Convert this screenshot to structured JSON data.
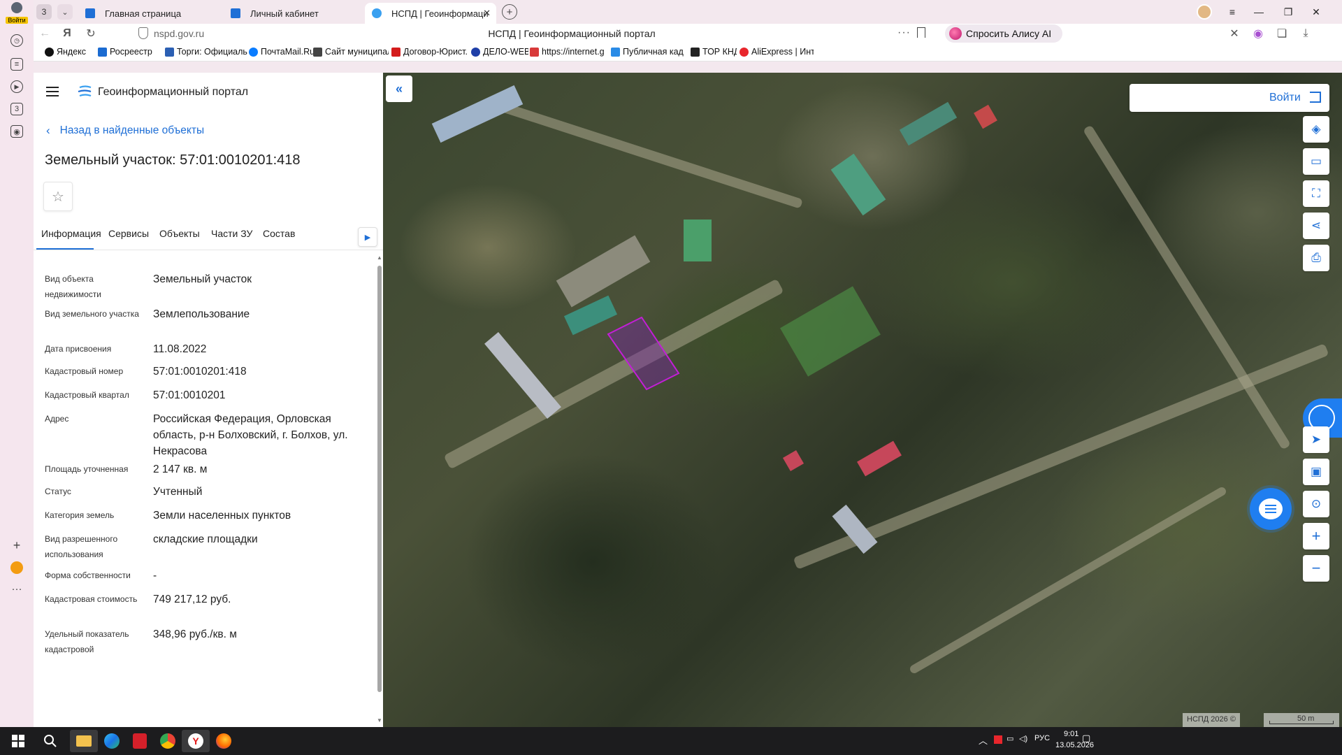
{
  "browser": {
    "profile_login": "Войти",
    "tab_count": "3",
    "tabs": [
      {
        "title": "Главная страница"
      },
      {
        "title": "Личный кабинет"
      },
      {
        "title": "НСПД | Геоинформаци"
      }
    ],
    "url": "nspd.gov.ru",
    "page_title": "НСПД | Геоинформационный портал",
    "alice_label": "Спросить Алису AI",
    "rail_badge": "3",
    "bookmarks": [
      {
        "label": "Яндекс",
        "color": "#111111"
      },
      {
        "label": "Росреестр",
        "color": "#1b6bd1"
      },
      {
        "label": "Торги: Официаль",
        "color": "#2b5fb3"
      },
      {
        "label": "ПочтаMail.Ru",
        "color": "#0a7cff"
      },
      {
        "label": "Сайт муниципаль",
        "color": "#444444"
      },
      {
        "label": "Договор-Юрист.",
        "color": "#d41c1c"
      },
      {
        "label": "ДЕЛО-WEB",
        "color": "#1f3fa8"
      },
      {
        "label": "https://internet.g",
        "color": "#d83a3a"
      },
      {
        "label": "Публичная кадас",
        "color": "#2a8be6"
      },
      {
        "label": "ТОР КНД",
        "color": "#222222"
      },
      {
        "label": "AliExpress | Интер",
        "color": "#e8262c"
      }
    ]
  },
  "portal": {
    "title": "Геоинформационный портал",
    "back_link": "Назад в найденные объекты",
    "object_title": "Земельный участок: 57:01:0010201:418",
    "tabs": [
      "Информация",
      "Сервисы",
      "Объекты",
      "Части ЗУ",
      "Состав"
    ],
    "active_tab": "Информация",
    "fields": [
      {
        "label": "Вид объекта недвижимости",
        "value": "Земельный участок"
      },
      {
        "label": "Вид земельного участка",
        "value": "Землепользование"
      },
      {
        "label": "Дата присвоения",
        "value": "11.08.2022"
      },
      {
        "label": "Кадастровый номер",
        "value": "57:01:0010201:418"
      },
      {
        "label": "Кадастровый квартал",
        "value": "57:01:0010201"
      },
      {
        "label": "Адрес",
        "value": "Российская Федерация, Орловская область, р-н Болховский, г. Болхов, ул. Некрасова"
      },
      {
        "label": "Площадь уточненная",
        "value": "2 147 кв. м"
      },
      {
        "label": "Статус",
        "value": "Учтенный"
      },
      {
        "label": "Категория земель",
        "value": "Земли населенных пунктов"
      },
      {
        "label": "Вид разрешенного использования",
        "value": "складские площадки"
      },
      {
        "label": "Форма собственности",
        "value": "-"
      },
      {
        "label": "Кадастровая стоимость",
        "value": "749 217,12 руб."
      },
      {
        "label": "Удельный показатель кадастровой",
        "value": "348,96 руб./кв. м"
      }
    ]
  },
  "map": {
    "login_label": "Войти",
    "copyright": "НСПД 2026 ©",
    "scale_label": "50 m",
    "parcel_color": "#c21fd6"
  },
  "taskbar": {
    "lang": "РУС",
    "time": "9:01",
    "date": "13.05.2026"
  }
}
